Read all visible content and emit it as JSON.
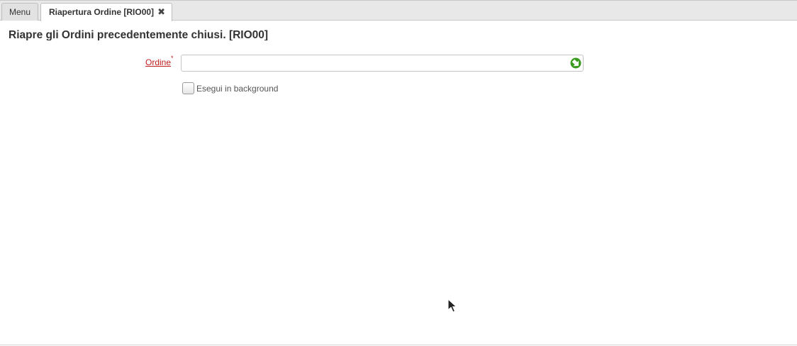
{
  "tabs": {
    "menu_label": "Menu",
    "active_label": "Riapertura Ordine [RIO00]",
    "close_symbol": "✖"
  },
  "page": {
    "title": "Riapre gli Ordini precedentemente chiusi. [RIO00]"
  },
  "form": {
    "order_field": {
      "label": "Ordine",
      "required_mark": "*",
      "value": "",
      "lookup_icon": "green-arrow-lookup-icon"
    },
    "background_option": {
      "label": "Esegui in background",
      "checked": false
    }
  },
  "colors": {
    "required_label": "#c0201e",
    "lookup_icon": "#3a9b1f",
    "tabbar_bg": "#e8e8e8"
  }
}
